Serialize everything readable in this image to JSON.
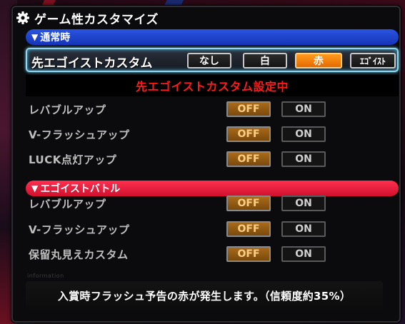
{
  "title": "ゲーム性カスタマイズ",
  "section_normal": {
    "label": "通常時"
  },
  "custom": {
    "label": "先エゴイストカスタム",
    "options": [
      "なし",
      "白",
      "赤",
      "ｴｺﾞｲｽﾄ"
    ],
    "selected": "赤"
  },
  "status_message": "先エゴイストカスタム設定中",
  "settings_normal": [
    {
      "label": "レバブルアップ",
      "off": "OFF",
      "on": "ON",
      "value": "OFF"
    },
    {
      "label": "V-フラッシュアップ",
      "off": "OFF",
      "on": "ON",
      "value": "OFF"
    },
    {
      "label": "LUCK点灯アップ",
      "off": "OFF",
      "on": "ON",
      "value": "OFF"
    }
  ],
  "section_battle": {
    "label": "エゴイストバトル"
  },
  "settings_battle": [
    {
      "label": "レバブルアップ",
      "off": "OFF",
      "on": "ON",
      "value": "OFF"
    },
    {
      "label": "V-フラッシュアップ",
      "off": "OFF",
      "on": "ON",
      "value": "OFF"
    },
    {
      "label": "保留丸見えカスタム",
      "off": "OFF",
      "on": "ON",
      "value": "OFF"
    }
  ],
  "information": {
    "label": "information",
    "text": "入賞時フラッシュ予告の赤が発生します。（信頼度約35%）"
  },
  "colors": {
    "section_normal": "#1f45d0",
    "section_battle": "#e81a38",
    "selected_option": "#f48a12",
    "status_text": "#ff1a1a",
    "off_selected": "#9a5e14"
  }
}
